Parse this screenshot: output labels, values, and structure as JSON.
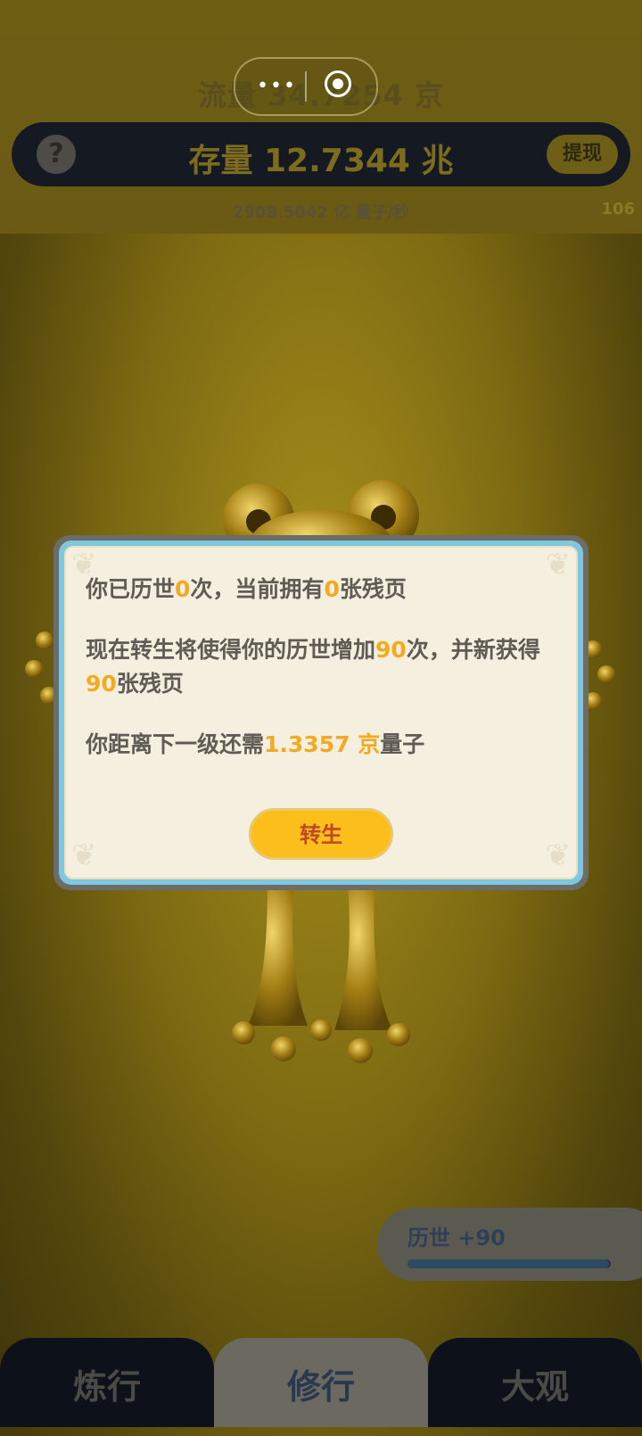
{
  "header": {
    "flow_text": "流量 34.7254 京",
    "stock_text": "存量 12.7344 兆",
    "help_label": "?",
    "withdraw_label": "提现",
    "rate_text": "2908.5042 亿  量子/秒",
    "side_count": "106"
  },
  "capsule": {
    "more_label": "•••"
  },
  "dialog": {
    "line1": {
      "a": "你已历世",
      "n1": "0",
      "b": "次，当前拥有",
      "n2": "0",
      "c": "张残页"
    },
    "line2": {
      "a": "现在转生将使得你的历世增加",
      "n1": "90",
      "b": "次，并新获得",
      "n2": "90",
      "c": "张残页"
    },
    "line3": {
      "a": "你距离下一级还需",
      "n1": "1.3357 京",
      "b": "量子"
    },
    "button_label": "转生"
  },
  "history": {
    "label": "历世 +90",
    "progress": 0.99
  },
  "tabs": [
    {
      "label": "炼行"
    },
    {
      "label": "修行"
    },
    {
      "label": "大观"
    }
  ],
  "colors": {
    "highlight": "#f4a921",
    "button": "#fbbe1a",
    "dialog_border": "#7ec7df"
  }
}
